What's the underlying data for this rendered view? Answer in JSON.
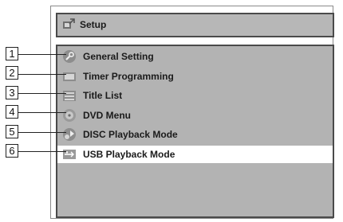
{
  "title": "Setup",
  "menu": [
    {
      "number": "1",
      "label": "General Setting",
      "icon": "wrench-icon",
      "selected": false
    },
    {
      "number": "2",
      "label": "Timer Programming",
      "icon": "timer-icon",
      "selected": false
    },
    {
      "number": "3",
      "label": "Title List",
      "icon": "list-icon",
      "selected": false
    },
    {
      "number": "4",
      "label": "DVD Menu",
      "icon": "disc-icon",
      "selected": false
    },
    {
      "number": "5",
      "label": "DISC Playback Mode",
      "icon": "disc-playback-icon",
      "selected": false
    },
    {
      "number": "6",
      "label": "USB Playback Mode",
      "icon": "usb-icon",
      "selected": true
    }
  ],
  "colors": {
    "panel_bg": "#b3b3b3",
    "selected_bg": "#ffffff",
    "border": "#4a4a4a"
  }
}
